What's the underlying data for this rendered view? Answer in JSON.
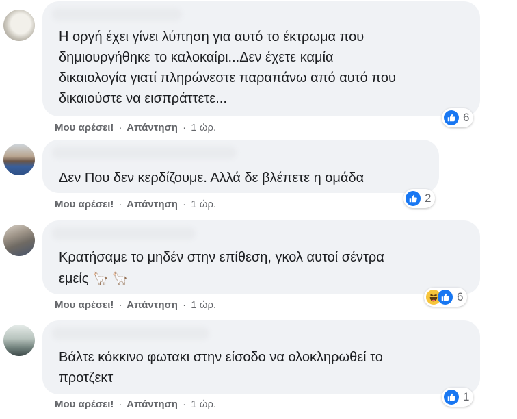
{
  "comments": [
    {
      "text_lines": [
        "Η οργή έχει γίνει λύπηση για αυτό το έκτρωμα που",
        "δημιουργήθηκε το καλοκαίρι...Δεν έχετε καμία",
        "δικαιολογία γιατί πληρώνεστε παραπάνω από αυτό που",
        "δικαιούστε να εισπράττετε..."
      ],
      "like": "Μου αρέσει!",
      "reply": "Απάντηση",
      "time": "1 ώρ.",
      "reaction_count": "6",
      "reactions": [
        "like-icon"
      ]
    },
    {
      "text_lines": [
        "Δεν Που δεν κερδίζουμε. Αλλά δε βλέπετε η ομάδα"
      ],
      "like": "Μου αρέσει!",
      "reply": "Απάντηση",
      "time": "1 ώρ.",
      "reaction_count": "2",
      "reactions": [
        "like-icon"
      ]
    },
    {
      "text_lines": [
        "Κρατήσαμε το μηδέν στην επίθεση, γκολ αυτοί σέντρα",
        "εμείς"
      ],
      "emoji": "🦙 🦙",
      "like": "Μου αρέσει!",
      "reply": "Απάντηση",
      "time": "1 ώρ.",
      "reaction_count": "6",
      "reactions": [
        "haha-icon",
        "like-icon"
      ]
    },
    {
      "text_lines": [
        "Βάλτε κόκκινο φωτακι στην είσοδο να ολοκληρωθεί το",
        "προτζεκτ"
      ],
      "like": "Μου αρέσει!",
      "reply": "Απάντηση",
      "time": "1 ώρ.",
      "reaction_count": "1",
      "reactions": [
        "like-icon"
      ]
    }
  ],
  "separator": "·",
  "colors": {
    "bubble": "#f0f2f5",
    "like_blue": "#1877f2",
    "meta_gray": "#65676b",
    "haha_yellow": "#f7c53b"
  }
}
